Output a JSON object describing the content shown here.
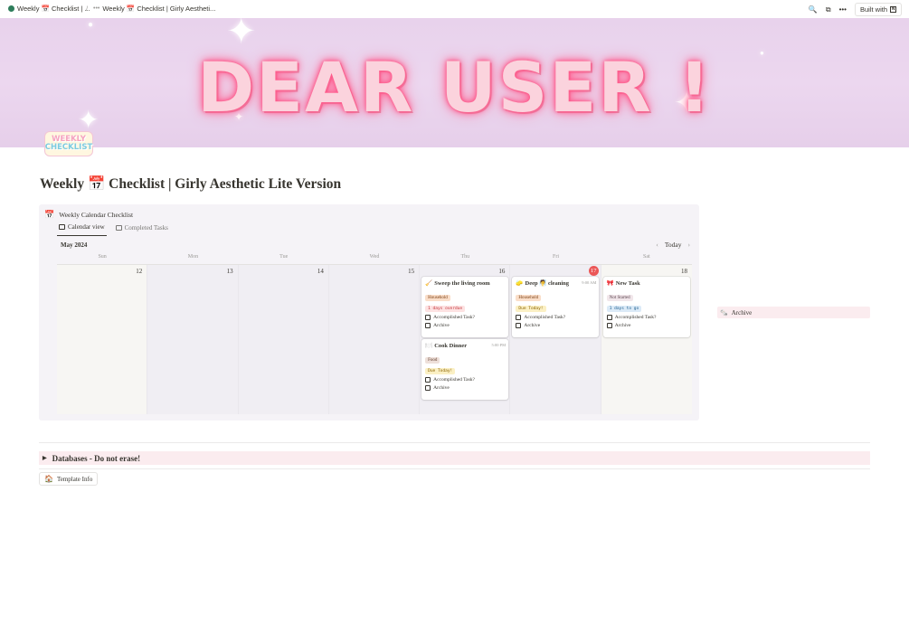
{
  "topbar": {
    "crumb1": "Weekly 📅 Checklist | ...",
    "separator": "/",
    "crumb2": "Weekly 📅 Checklist | Girly Aestheti...",
    "built_with": "Built with",
    "built_logo": "N",
    "search_icon": "🔍",
    "duplicate_icon": "⧉",
    "more_icon": "•••"
  },
  "cover": {
    "title": "DEAR USER !"
  },
  "page_icon": {
    "line1": "WEEKLY",
    "line2": "CHECKLIST"
  },
  "page": {
    "title": "Weekly 📅 Checklist | Girly Aesthetic Lite Version"
  },
  "calendar": {
    "emoji": "📅",
    "title": "Weekly Calendar Checklist",
    "views": [
      "Calendar view",
      "Completed Tasks"
    ],
    "month": "May 2024",
    "today_label": "Today",
    "prev": "‹",
    "next": "›",
    "weekdays": [
      "Sun",
      "Mon",
      "Tue",
      "Wed",
      "Thu",
      "Fri",
      "Sat"
    ],
    "days": [
      "12",
      "13",
      "14",
      "15",
      "16",
      "17",
      "18"
    ],
    "cards": [
      {
        "icon": "🧹",
        "title": "Sweep the living room",
        "time": "",
        "tag": "Household",
        "status": "1 days overdue",
        "check1": "Accomplished Task?",
        "check2": "Archive"
      },
      {
        "icon": "🍽️",
        "title": "Cook Dinner",
        "time": "5:00 PM",
        "tag": "Food",
        "status": "Due Today!",
        "check1": "Accomplished Task?",
        "check2": "Archive"
      },
      {
        "icon": "🧽",
        "title": "Deep 🧖 cleaning",
        "time": "9:00 AM",
        "tag": "Household",
        "status": "Due Today!",
        "check1": "Accomplished Task?",
        "check2": "Archive"
      },
      {
        "icon": "🎀",
        "title": "New Task",
        "time": "",
        "tag": "Not Started",
        "status": "1 days to go",
        "check1": "Accomplished Task?",
        "check2": "Archive"
      }
    ]
  },
  "archive": {
    "icon": "🗞️",
    "label": "Archive"
  },
  "toggle": {
    "arrow": "▶",
    "label": "Databases - Do not erase!"
  },
  "template_info": {
    "icon": "🏠",
    "label": "Template Info"
  },
  "colors": {
    "accent_pink": "#fbecef",
    "today_red": "#eb5757",
    "cover_lilac": "#e8d2ec",
    "neon_pink": "#ff4f86"
  }
}
